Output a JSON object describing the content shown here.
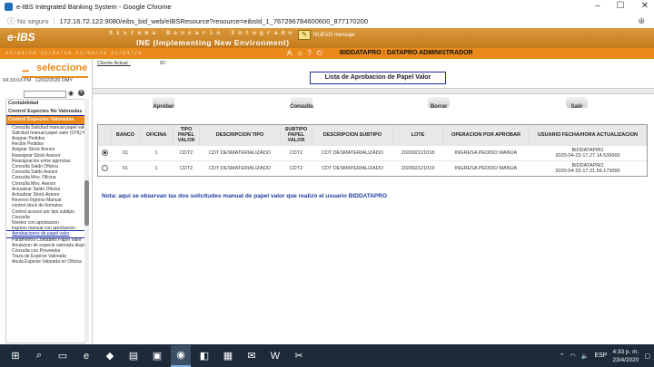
{
  "browser": {
    "window_title": "e-IBS Integrated Banking System - Google Chrome",
    "security_label": "No seguro",
    "url": "172.16.72.122:9080/eibs_bid_web/eIBSResource?resource=eibsId_1_767296784600600_877170200"
  },
  "banner": {
    "logo": "e·IBS",
    "system_name": "Sistema Bancario Integrado",
    "environment": "INE (Implementing New Environment)",
    "message_label": "NUEVO mensaje"
  },
  "userbar": {
    "dates": "21/04/20    21/04/20    21/04/20    21/04/20",
    "user": "BIDDATAPRO : DATAPRO ADMINISTRADOR"
  },
  "left": {
    "seleccione": "seleccione",
    "time": "04:33:03 PM",
    "date": "12/02/2020",
    "format": "DMY",
    "menu": {
      "header1": "Contabilidad",
      "header2": "Control Especies No Valoradas",
      "selected_section": "Control Especies Valoradas",
      "items": [
        "Consulta Solicitud manual papel valor",
        "Solicitud manual papel valor (CHQ ME)",
        "Asignar Pedidos",
        "Recibir Pedidos",
        "Asignar Stock Asesor",
        "Reasignar Stock Asesor",
        "Reasignacion entre agencias",
        "Consulta Saldo Oficina",
        "Consulta Saldo Asesor",
        "Consulta Mov. Oficina",
        "Consulta Mov. Asesor",
        "Actualizar Saldo Oficina",
        "Actualizar Stock Asesor",
        "Reverso Ingreso Manual",
        "control stock de formatos",
        "Control acceso por tipo subtipo",
        "Consulta",
        "Niveles con aprobacion",
        "Ingreso manual con aprobacion"
      ],
      "highlighted_item": "Aprobaciones de papel valor",
      "items_after": [
        "Parametros Contables Papel Valor",
        "Anulacion de especie valorada disponible",
        "Consulta con Proveedor",
        "Traza de Especie Valorada",
        "Anula Especie Valorada en Oficina"
      ]
    }
  },
  "main": {
    "client_label": "Cliente Actual :",
    "id_label": "ID:",
    "page_title": "Lista de Aprobacion de Papel Valor",
    "toolbar": {
      "approve": "Aprobar",
      "query": "Consulta",
      "delete": "Borrar",
      "exit": "Salir"
    },
    "table": {
      "headers": [
        "",
        "BANCO",
        "OFICINA",
        "TIPO PAPEL VALOR",
        "DESCRIPCION TIPO",
        "SUBTIPO PAPEL VALOR",
        "DESCRIPCION SUBTIPO",
        "LOTE",
        "OPERACION POR APROBAR",
        "USUARIO FECHA/HORA ACTUALIZACION"
      ],
      "rows": [
        {
          "selected": true,
          "banco": "01",
          "oficina": "1",
          "tipo": "CDT2",
          "desc_tipo": "CDT DESMATERIALIZADO",
          "subtipo": "CDT2",
          "desc_subtipo": "CDT DESMATERIALIZADO",
          "lote": "202002121018",
          "operacion": "INGRESA PEDIDO MANUA",
          "usuario": "BIDDATAPRO",
          "fecha": "2020-04-23-17.27.14.539000"
        },
        {
          "selected": false,
          "banco": "01",
          "oficina": "1",
          "tipo": "CDT2",
          "desc_tipo": "CDT DESMATERIALIZADO",
          "subtipo": "CDT2",
          "desc_subtipo": "CDT DESMATERIALIZADO",
          "lote": "202002121019",
          "operacion": "INGRESA PEDIDO MANUA",
          "usuario": "BIDDATAPRO",
          "fecha": "2020-04-23-17.31.59.173000"
        }
      ]
    },
    "note": "Nota: aquí se observan las dos solicitudes manual de papel valor que realizó el usuario BIDDATAPRO"
  },
  "taskbar": {
    "lang": "ESP",
    "time": "4:33 p. m.",
    "date": "23/4/2020"
  }
}
